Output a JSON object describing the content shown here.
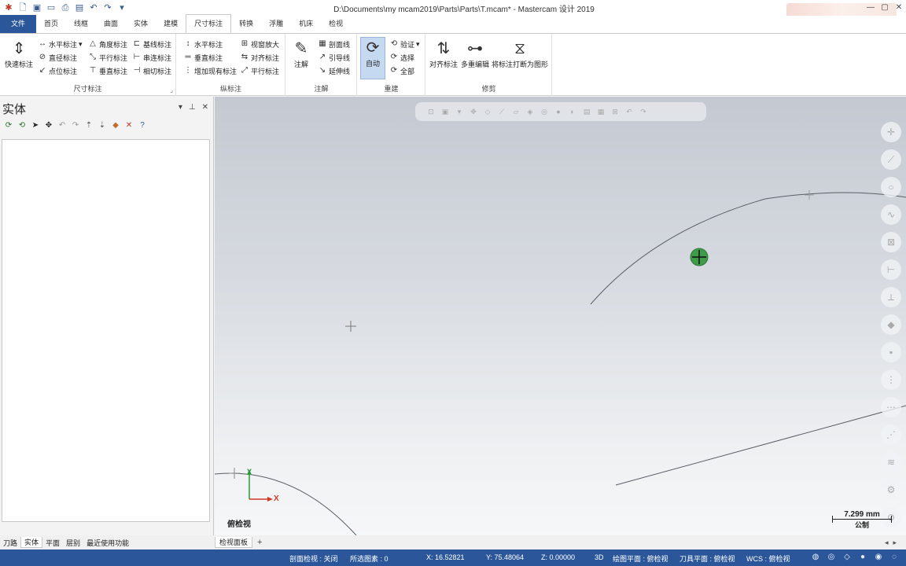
{
  "window": {
    "title": "D:\\Documents\\my mcam2019\\Parts\\Parts\\T.mcam* - Mastercam 设计 2019",
    "quick_access_icons": [
      "app-logo-icon",
      "new-file-icon",
      "save-icon",
      "open-folder-icon",
      "print-icon",
      "save-as-icon",
      "undo-icon",
      "redo-icon",
      "customize-icon"
    ]
  },
  "ribbon_tabs": [
    {
      "label": "文件",
      "kind": "file"
    },
    {
      "label": "首页"
    },
    {
      "label": "线框"
    },
    {
      "label": "曲面"
    },
    {
      "label": "实体"
    },
    {
      "label": "建模"
    },
    {
      "label": "尺寸标注",
      "active": true
    },
    {
      "label": "转换"
    },
    {
      "label": "浮雕"
    },
    {
      "label": "机床"
    },
    {
      "label": "检视"
    }
  ],
  "ribbon": {
    "dimension_group": {
      "label": "尺寸标注",
      "quick_dimension": "快速标注",
      "horizontal": "水平标注",
      "diameter": "直径标注",
      "point": "点位标注",
      "angle": "角度标注",
      "parallel": "平行标注",
      "vertical": "垂直标注",
      "baseline": "基线标注",
      "chained": "串连标注",
      "tangent": "相切标注"
    },
    "ordinate_group": {
      "label": "纵标注",
      "horizontal": "水平标注",
      "vertical": "垂直标注",
      "add_existing": "增加现有标注",
      "window_zoom": "视窗放大",
      "align": "对齐标注",
      "parallel": "平行标注"
    },
    "notes_group": {
      "label": "注解",
      "note": "注解",
      "hatch": "剖面线",
      "leader": "引导线",
      "witness": "延伸线"
    },
    "regen_group": {
      "label": "重建",
      "auto": "自动",
      "validate": "验证",
      "select": "选择",
      "all": "全部"
    },
    "trim_group": {
      "label": "修剪",
      "align_dims": "对齐标注",
      "multi_edit": "多重编辑",
      "break_to_geometry": "将标注打断为图形"
    }
  },
  "left_panel": {
    "title": "实体",
    "bottom_tabs": [
      {
        "label": "刀路"
      },
      {
        "label": "实体",
        "active": true
      },
      {
        "label": "平面"
      },
      {
        "label": "层别"
      },
      {
        "label": "最近使用功能"
      }
    ]
  },
  "viewport": {
    "view_name": "俯检视",
    "scale_value": "7.299 mm",
    "scale_unit": "公制",
    "axis_y": "Y",
    "axis_x": "X",
    "tab_label": "检视面板",
    "add_tab": "+"
  },
  "status_bar": {
    "section_view": "剖面检视 : 关闭",
    "selected": "所选图素 : 0",
    "x": "X:   16.52821",
    "y": "Y:   75.48064",
    "z": "Z:   0.00000",
    "mode": "3D",
    "cplane": "绘图平面 : 俯检视",
    "tplane": "刀具平面 : 俯检视",
    "wcs": "WCS : 俯检视"
  },
  "colors": {
    "accent": "#2b579a",
    "cursor_green": "#3f9a4a"
  }
}
